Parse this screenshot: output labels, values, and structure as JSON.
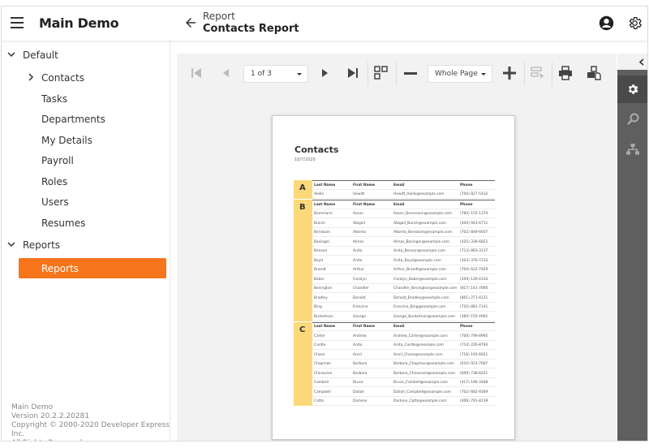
{
  "header": {
    "app_title": "Main Demo",
    "breadcrumb_parent": "Report",
    "page_title": "Contacts Report",
    "icons": {
      "menu": "hamburger-icon",
      "back": "arrow-left-icon",
      "user": "user-circle-icon",
      "settings": "gear-icon"
    }
  },
  "sidebar": {
    "groups": [
      {
        "label": "Default",
        "expanded": true,
        "items": [
          {
            "label": "Contacts",
            "has_children": true
          },
          {
            "label": "Tasks"
          },
          {
            "label": "Departments"
          },
          {
            "label": "My Details"
          },
          {
            "label": "Payroll"
          },
          {
            "label": "Roles"
          },
          {
            "label": "Users"
          },
          {
            "label": "Resumes"
          }
        ]
      },
      {
        "label": "Reports",
        "expanded": true,
        "items": [
          {
            "label": "Reports",
            "active": true
          }
        ]
      }
    ],
    "footer": {
      "line1": "Main Demo",
      "line2": "Version 20.2.2.20281",
      "line3": "Copyright © 2000-2020 Developer Express Inc.",
      "line4": "All Rights Reserved"
    },
    "accent_color": "#f7751b"
  },
  "toolbar": {
    "page_selector": "1 of 3",
    "zoom_selector": "Whole Page",
    "buttons": [
      "first-page",
      "previous-page",
      "next-page",
      "last-page",
      "multipage-toggle",
      "zoom-out",
      "zoom-in",
      "highlight-editing-fields",
      "print",
      "export"
    ]
  },
  "report": {
    "title": "Contacts",
    "date": "10/7/2020",
    "columns": [
      "Last Name",
      "First Name",
      "Email",
      "Phone"
    ],
    "groups": [
      {
        "letter": "A",
        "rows": [
          [
            "Aiello",
            "Hewitt",
            "Hewitt_Aiello@example.com",
            "(704) 827-5432"
          ]
        ]
      },
      {
        "letter": "B",
        "rows": [
          [
            "Bornmann",
            "Aaron",
            "Aaron_Bornmann@example.com",
            "(760) 155-1374"
          ],
          [
            "Bunch",
            "Abigail",
            "Abigail_Bunch@example.com",
            "(404) 943-6711"
          ],
          [
            "Bernbam",
            "Alberta",
            "Alberta_Bernbam@example.com",
            "(702) 849-6647"
          ],
          [
            "Basinger",
            "Almas",
            "Almas_Basinger@example.com",
            "(425) 336-6822"
          ],
          [
            "Benson",
            "Anita",
            "Anita_Benson@example.com",
            "(713) 863-3137"
          ],
          [
            "Boyd",
            "Anita",
            "Anita_Boyd@example.com",
            "(303) 376-7233"
          ],
          [
            "Brandt",
            "Arthur",
            "Arthur_Brandt@example.com",
            "(704) 622-7929"
          ],
          [
            "Baker",
            "Carolyn",
            "Carolyn_Baker@example.com",
            "(209) 126-4334"
          ],
          [
            "Bevington",
            "Chandler",
            "Chandler_Bevington@example.com",
            "(817) 141-7866"
          ],
          [
            "Bradley",
            "Donald",
            "Donald_Bradley@example.com",
            "(801) 271-4121"
          ],
          [
            "Bing",
            "Francine",
            "Francine_Bing@example.com",
            "(720) 881-7141"
          ],
          [
            "Burkelman",
            "George",
            "George_Burkelman@example.com",
            "(360) 155-4962"
          ]
        ]
      },
      {
        "letter": "C",
        "rows": [
          [
            "Carter",
            "Andrew",
            "Andrew_Carter@example.com",
            "(708) 799-8995"
          ],
          [
            "Cardle",
            "Anita",
            "Anita_Cardle@example.com",
            "(714) 226-8794"
          ],
          [
            "Chase",
            "Anvil",
            "Anvil_Chase@example.com",
            "(718) 193-6621"
          ],
          [
            "Chapman",
            "Barbara",
            "Barbara_Chapman@example.com",
            "(610) 923-7667"
          ],
          [
            "Chinavare",
            "Barbara",
            "Barbara_Chinavare@example.com",
            "(609) 738-8251"
          ],
          [
            "Cambell",
            "Bruce",
            "Bruce_Cambell@example.com",
            "(417) 166-3268"
          ],
          [
            "Campbell",
            "Dailah",
            "Dailah_Campbell@example.com",
            "(702) 682-9269"
          ],
          [
            "Catto",
            "Darlene",
            "Darlene_Catto@example.com",
            "(406) 791-8139"
          ]
        ]
      }
    ],
    "group_color": "#fbd97a"
  },
  "side_panel": {
    "buttons": [
      {
        "name": "properties",
        "icon": "gear-icon",
        "active": true
      },
      {
        "name": "search",
        "icon": "search-icon",
        "active": false
      },
      {
        "name": "document-map",
        "icon": "document-map-icon",
        "active": false
      }
    ]
  }
}
